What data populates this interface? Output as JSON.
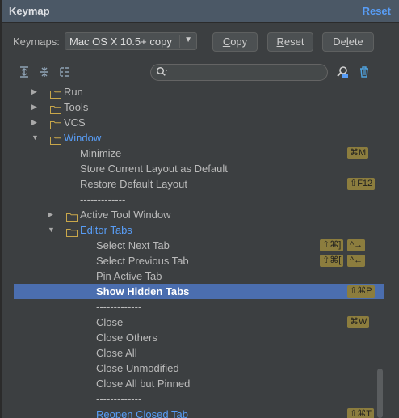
{
  "header": {
    "title": "Keymap",
    "reset_link": "Reset"
  },
  "keymaps": {
    "label": "Keymaps:",
    "selected": "Mac OS X 10.5+ copy",
    "copy_label": "Copy",
    "reset_label": "Reset",
    "delete_label": "Delete"
  },
  "toolbar": {
    "icons": [
      "expand-all-icon",
      "collapse-all-icon",
      "tree-view-icon",
      "find-by-shortcut-icon",
      "clear-filter-icon"
    ]
  },
  "tree": {
    "rows": [
      {
        "label": "Run",
        "kind": "folder",
        "expanded": false
      },
      {
        "label": "Tools",
        "kind": "folder",
        "expanded": false
      },
      {
        "label": "VCS",
        "kind": "folder",
        "expanded": false
      },
      {
        "label": "Window",
        "kind": "folder",
        "expanded": true
      },
      {
        "label": "Minimize",
        "shortcuts": [
          "⌘M"
        ]
      },
      {
        "label": "Store Current Layout as Default",
        "shortcuts": []
      },
      {
        "label": "Restore Default Layout",
        "shortcuts": [
          "⇧F12"
        ]
      },
      {
        "label": "-------------",
        "shortcuts": []
      },
      {
        "label": "Active Tool Window",
        "kind": "folder",
        "expanded": false
      },
      {
        "label": "Editor Tabs",
        "kind": "folder",
        "expanded": true
      },
      {
        "label": "Select Next Tab",
        "shortcuts": [
          "⇧⌘]",
          "^→"
        ]
      },
      {
        "label": "Select Previous Tab",
        "shortcuts": [
          "⇧⌘[",
          "^←"
        ]
      },
      {
        "label": "Pin Active Tab",
        "shortcuts": []
      },
      {
        "label": "Show Hidden Tabs",
        "shortcuts": [
          "⇧⌘P"
        ],
        "selected": true
      },
      {
        "label": "-------------",
        "shortcuts": []
      },
      {
        "label": "Close",
        "shortcuts": [
          "⌘W"
        ]
      },
      {
        "label": "Close Others",
        "shortcuts": []
      },
      {
        "label": "Close All",
        "shortcuts": []
      },
      {
        "label": "Close Unmodified",
        "shortcuts": []
      },
      {
        "label": "Close All but Pinned",
        "shortcuts": []
      },
      {
        "label": "-------------",
        "shortcuts": []
      },
      {
        "label": "Reopen Closed Tab",
        "shortcuts": [
          "⇧⌘T"
        ],
        "link": true
      }
    ]
  },
  "colors": {
    "accent": "#589df6",
    "selection": "#4b6eaf",
    "shortcut_bg": "#8c7d3e",
    "folder": "#c9a74a"
  }
}
